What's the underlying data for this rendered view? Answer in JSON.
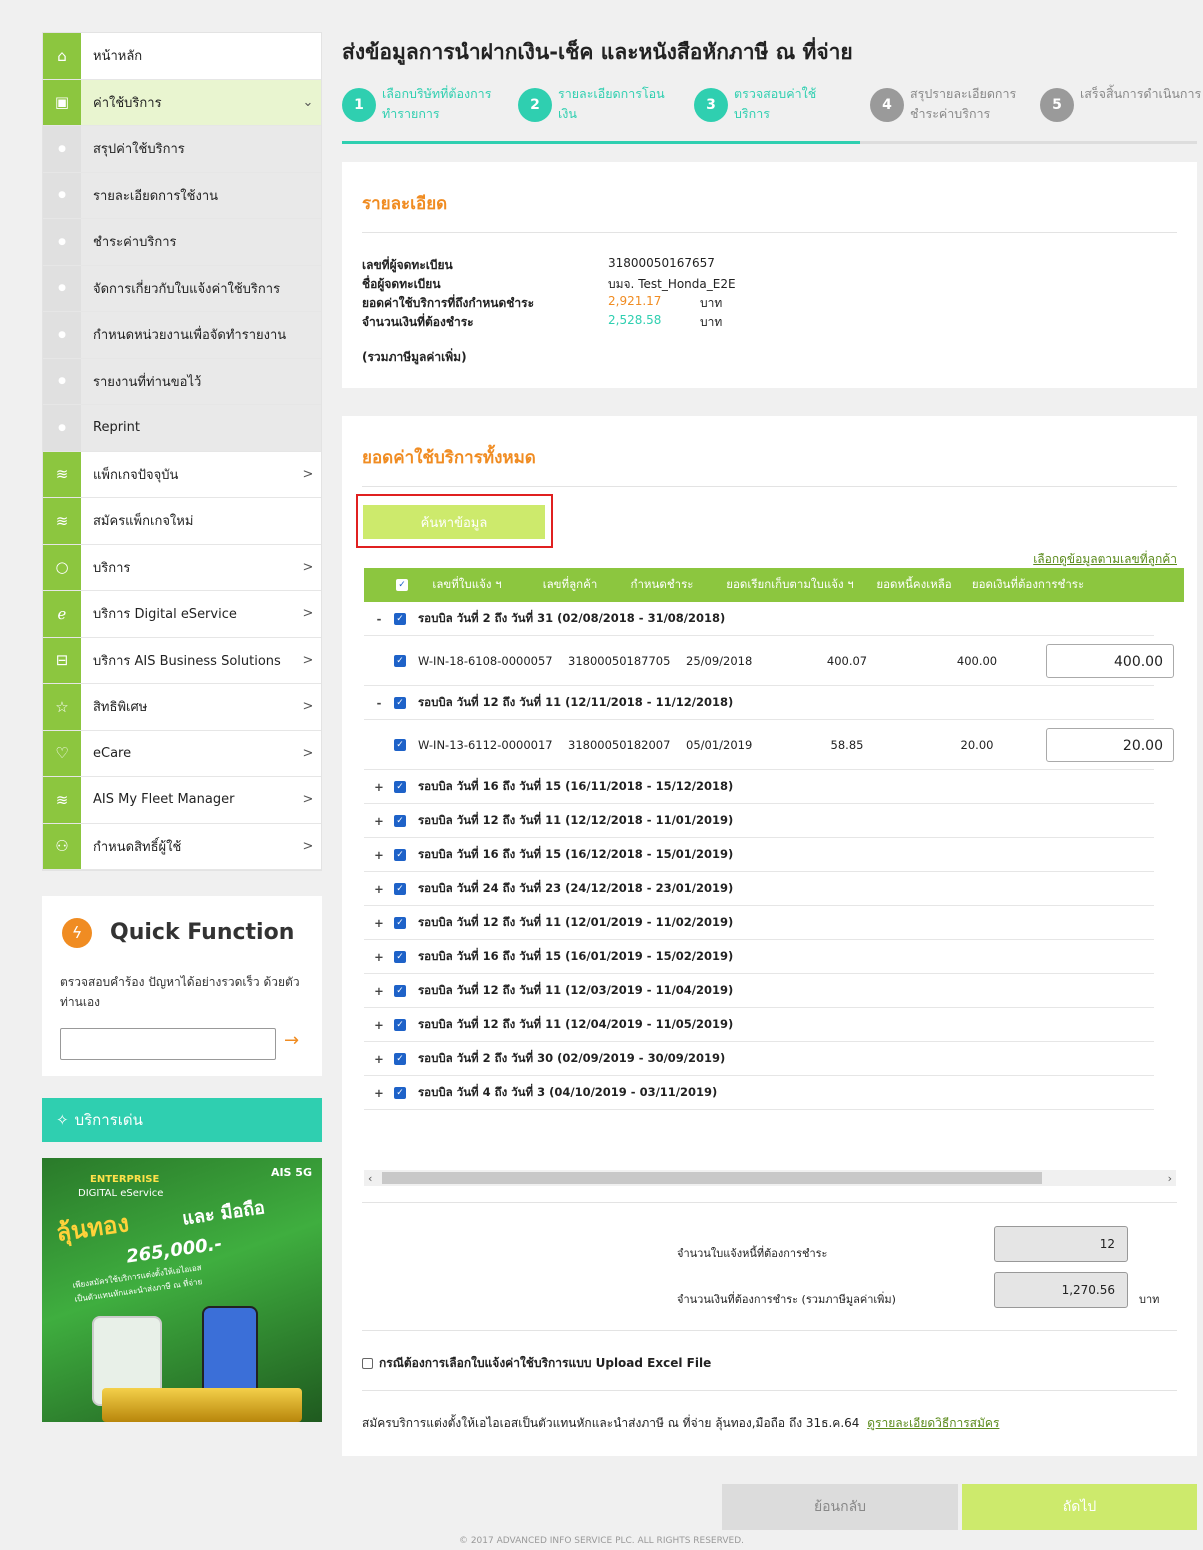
{
  "colors": {
    "brand_green": "#8cc63f",
    "accent_orange": "#f08c22",
    "step_active": "#2fcfb0",
    "step_inactive": "#9a9a9a"
  },
  "sidebar": {
    "items": [
      {
        "label": "หน้าหลัก",
        "icon": "home-icon",
        "sub": false,
        "chevron": ""
      },
      {
        "label": "ค่าใช้บริการ",
        "icon": "bill-icon",
        "sub": false,
        "chevron": "⌄",
        "active": true
      },
      {
        "label": "สรุปค่าใช้บริการ",
        "icon": "dot-icon",
        "sub": true,
        "chevron": ""
      },
      {
        "label": "รายละเอียดการใช้งาน",
        "icon": "dot-icon",
        "sub": true,
        "chevron": ""
      },
      {
        "label": "ชำระค่าบริการ",
        "icon": "dot-icon",
        "sub": true,
        "chevron": ""
      },
      {
        "label": "จัดการเกี่ยวกับใบแจ้งค่าใช้บริการ",
        "icon": "dot-icon",
        "sub": true,
        "chevron": ""
      },
      {
        "label": "กำหนดหน่วยงานเพื่อจัดทำรายงาน",
        "icon": "dot-icon",
        "sub": true,
        "chevron": ""
      },
      {
        "label": "รายงานที่ท่านขอไว้",
        "icon": "dot-icon",
        "sub": true,
        "chevron": ""
      },
      {
        "label": "Reprint",
        "icon": "dot-icon",
        "sub": true,
        "chevron": ""
      },
      {
        "label": "แพ็กเกจปัจจุบัน",
        "icon": "layers-icon",
        "sub": false,
        "chevron": ">"
      },
      {
        "label": "สมัครแพ็กเกจใหม่",
        "icon": "layers-icon",
        "sub": false,
        "chevron": ""
      },
      {
        "label": "บริการ",
        "icon": "circle-icon",
        "sub": false,
        "chevron": ">"
      },
      {
        "label": "บริการ Digital eService",
        "icon": "e-icon",
        "sub": false,
        "chevron": ">"
      },
      {
        "label": "บริการ AIS Business Solutions",
        "icon": "briefcase-icon",
        "sub": false,
        "chevron": ">"
      },
      {
        "label": "สิทธิพิเศษ",
        "icon": "star-icon",
        "sub": false,
        "chevron": ">"
      },
      {
        "label": "eCare",
        "icon": "heart-icon",
        "sub": false,
        "chevron": ">"
      },
      {
        "label": "AIS My Fleet Manager",
        "icon": "layers-icon",
        "sub": false,
        "chevron": ">"
      },
      {
        "label": "กำหนดสิทธิ์ผู้ใช้",
        "icon": "users-icon",
        "sub": false,
        "chevron": ">"
      }
    ]
  },
  "quick": {
    "title": "Quick Function",
    "desc": "ตรวจสอบคำร้อง ปัญหาได้อย่างรวดเร็ว ด้วยตัวท่านเอง",
    "input_value": "",
    "go": "→"
  },
  "featured": {
    "title": "บริการเด่น"
  },
  "banner": {
    "brand": "AIS 5G",
    "line1": "ENTERPRISE",
    "line2": "DIGITAL eService",
    "headline1": "ลุ้นทอง",
    "headline2": "และ มือถือ",
    "amount": "265,000.-",
    "sub": "เพียงสมัครใช้บริการแต่งตั้งให้เอไอเอส",
    "sub2": "เป็นตัวแทนหักและนำส่งภาษี ณ ที่จ่าย"
  },
  "page": {
    "title": "ส่งข้อมูลการนำฝากเงิน-เช็ค และหนังสือหักภาษี ณ ที่จ่าย"
  },
  "steps": [
    {
      "num": "1",
      "label": "เลือกบริษัทที่ต้องการทำรายการ",
      "active": true
    },
    {
      "num": "2",
      "label": "รายละเอียดการโอนเงิน",
      "active": true
    },
    {
      "num": "3",
      "label": "ตรวจสอบค่าใช้บริการ",
      "active": true
    },
    {
      "num": "4",
      "label": "สรุปรายละเอียดการชำระค่าบริการ",
      "active": false
    },
    {
      "num": "5",
      "label": "เสร็จสิ้นการดำเนินการ",
      "active": false
    }
  ],
  "detail": {
    "heading": "รายละเอียด",
    "rows": [
      {
        "label": "เลขที่ผู้จดทะเบียน",
        "value": "31800050167657",
        "unit": ""
      },
      {
        "label": "ชื่อผู้จดทะเบียน",
        "value": "บมจ. Test_Honda_E2E",
        "unit": ""
      },
      {
        "label": "ยอดค่าใช้บริการที่ถึงกำหนดชำระ",
        "value": "2,921.17",
        "unit": "บาท"
      },
      {
        "label": "จำนวนเงินที่ต้องชำระ",
        "value": "2,528.58",
        "unit": "บาท"
      }
    ],
    "vat_note": "(รวมภาษีมูลค่าเพิ่ม)"
  },
  "total": {
    "heading": "ยอดค่าใช้บริการทั้งหมด",
    "search_btn": "ค้นหาข้อมูล",
    "select_link": "เลือกดูข้อมูลตามเลขที่ลูกค้า",
    "columns": [
      "เลขที่ใบแจ้ง ฯ",
      "เลขที่ลูกค้า",
      "กำหนดชำระ",
      "ยอดเรียกเก็บตามใบแจ้ง ฯ",
      "ยอดหนี้คงเหลือ",
      "ยอดเงินที่ต้องการชำระ"
    ],
    "rows": [
      {
        "type": "group",
        "pm": "-",
        "label": "รอบบิล วันที่ 2 ถึง วันที่ 31 (02/08/2018 - 31/08/2018)"
      },
      {
        "type": "item",
        "inv": "W-IN-18-6108-0000057",
        "cust": "31800050187705",
        "due": "25/09/2018",
        "billed": "400.07",
        "remain": "400.00",
        "pay": "400.00"
      },
      {
        "type": "group",
        "pm": "-",
        "label": "รอบบิล วันที่ 12 ถึง วันที่ 11 (12/11/2018 - 11/12/2018)"
      },
      {
        "type": "item",
        "inv": "W-IN-13-6112-0000017",
        "cust": "31800050182007",
        "due": "05/01/2019",
        "billed": "58.85",
        "remain": "20.00",
        "pay": "20.00"
      },
      {
        "type": "group",
        "pm": "+",
        "label": "รอบบิล วันที่ 16 ถึง วันที่ 15 (16/11/2018 - 15/12/2018)"
      },
      {
        "type": "group",
        "pm": "+",
        "label": "รอบบิล วันที่ 12 ถึง วันที่ 11 (12/12/2018 - 11/01/2019)"
      },
      {
        "type": "group",
        "pm": "+",
        "label": "รอบบิล วันที่ 16 ถึง วันที่ 15 (16/12/2018 - 15/01/2019)"
      },
      {
        "type": "group",
        "pm": "+",
        "label": "รอบบิล วันที่ 24 ถึง วันที่ 23 (24/12/2018 - 23/01/2019)"
      },
      {
        "type": "group",
        "pm": "+",
        "label": "รอบบิล วันที่ 12 ถึง วันที่ 11 (12/01/2019 - 11/02/2019)"
      },
      {
        "type": "group",
        "pm": "+",
        "label": "รอบบิล วันที่ 16 ถึง วันที่ 15 (16/01/2019 - 15/02/2019)"
      },
      {
        "type": "group",
        "pm": "+",
        "label": "รอบบิล วันที่ 12 ถึง วันที่ 11 (12/03/2019 - 11/04/2019)"
      },
      {
        "type": "group",
        "pm": "+",
        "label": "รอบบิล วันที่ 12 ถึง วันที่ 11 (12/04/2019 - 11/05/2019)"
      },
      {
        "type": "group",
        "pm": "+",
        "label": "รอบบิล วันที่ 2 ถึง วันที่ 30 (02/09/2019 - 30/09/2019)"
      },
      {
        "type": "group",
        "pm": "+",
        "label": "รอบบิล วันที่ 4 ถึง วันที่ 3 (04/10/2019 - 03/11/2019)"
      }
    ],
    "summary": {
      "count_label": "จำนวนใบแจ้งหนี้ที่ต้องการชำระ",
      "count": "12",
      "amount_label": "จำนวนเงินที่ต้องการชำระ (รวมภาษีมูลค่าเพิ่ม)",
      "amount": "1,270.56",
      "unit": "บาท"
    },
    "upload_label": "กรณีต้องการเลือกใบแจ้งค่าใช้บริการแบบ Upload Excel File",
    "promo_text": "สมัครบริการแต่งตั้งให้เอไอเอสเป็นตัวแทนหักและนำส่งภาษี ณ ที่จ่าย ลุ้นทอง,มือถือ ถึง 31ธ.ค.64",
    "promo_link": "ดูรายละเอียดวิธีการสมัคร"
  },
  "buttons": {
    "back": "ย้อนกลับ",
    "next": "ถัดไป"
  },
  "footer": "© 2017 ADVANCED INFO SERVICE PLC. ALL RIGHTS RESERVED."
}
